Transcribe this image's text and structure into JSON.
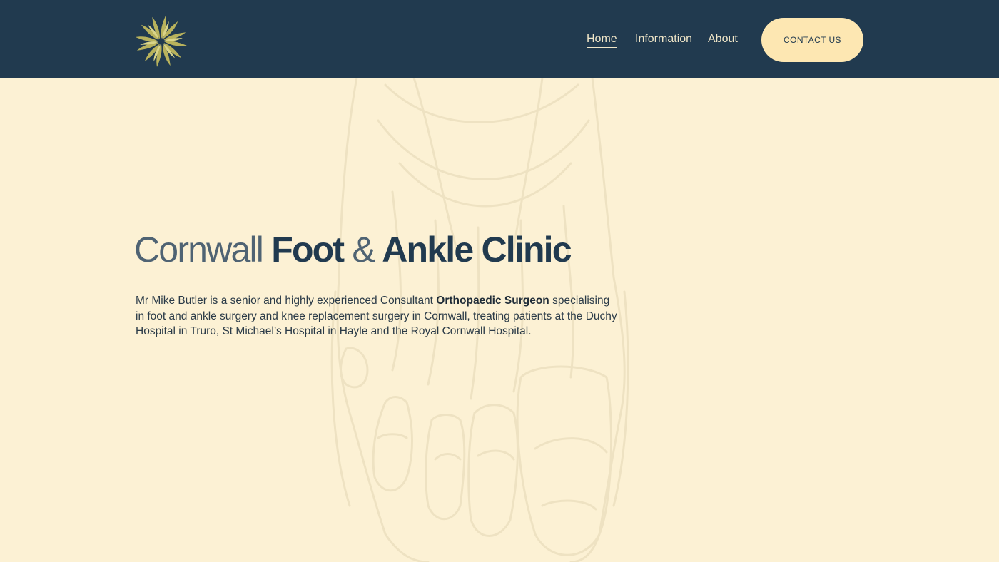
{
  "header": {
    "logo_icon": "sunburst-leaf-logo",
    "nav": [
      {
        "label": "Home",
        "active": true
      },
      {
        "label": "Information",
        "active": false
      },
      {
        "label": "About",
        "active": false
      }
    ],
    "contact_button": "CONTACT US"
  },
  "hero": {
    "title_part1": "Cornwall",
    "title_part2": "Foot",
    "title_amp": "&",
    "title_part3": "Ankle",
    "title_part4": "Clinic",
    "text_before": "Mr Mike Butler is a senior and highly experienced Consultant ",
    "text_bold": "Orthopaedic Surgeon",
    "text_after": " specialising in foot and ankle surgery and knee replacement surgery in Cornwall, treating patients at the Duchy Hospital in Truro, St Michael’s Hospital in Hayle and the Royal Cornwall Hospital."
  },
  "background": {
    "illustration": "foot-sketch-illustration"
  },
  "colors": {
    "header_bg": "#213a4f",
    "page_bg": "#fcf1d4",
    "accent_button": "#fde7b2",
    "logo_gold": "#b7b15a"
  }
}
